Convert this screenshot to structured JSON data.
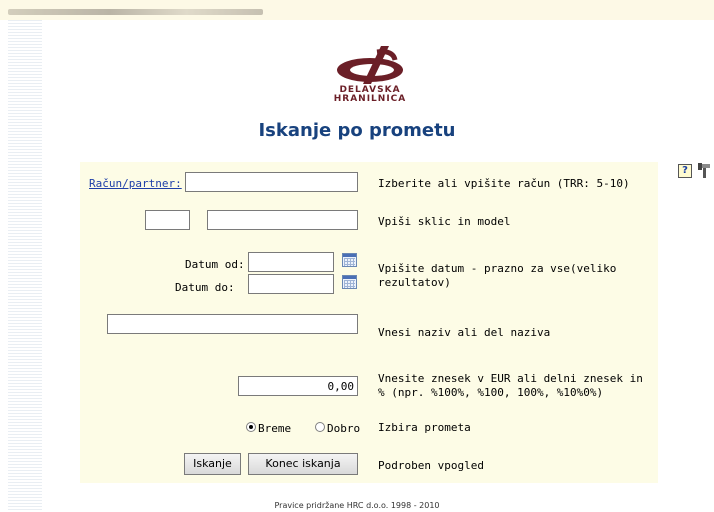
{
  "header": {
    "logo_line1": "DELAVSKA",
    "logo_line2": "HRANILNICA",
    "title": "Iskanje po prometu"
  },
  "form": {
    "account_link": "Račun/partner:",
    "account_value": "",
    "account_hint": "Izberite ali vpišite račun (TRR: 5-10)",
    "reference_model_value": "",
    "reference_value": "",
    "reference_hint": "Vpiši sklic in model",
    "date_from_label": "Datum od:",
    "date_to_label": "Datum do:",
    "date_from_value": "",
    "date_to_value": "",
    "date_hint": "Vpišite datum - prazno za vse(veliko rezultatov)",
    "name_value": "",
    "name_hint": "Vnesi naziv ali del naziva",
    "amount_value": "0,00",
    "amount_hint": "Vnesite znesek v EUR ali delni znesek in % (npr. %100%, %100, 100%, %10%0%)",
    "radio_debit_label": "Breme",
    "radio_credit_label": "Dobro",
    "radio_selected": "Breme",
    "turnover_hint": "Izbira prometa",
    "search_button": "Iskanje",
    "end_search_button": "Konec iskanja",
    "detail_hint": "Podroben vpogled"
  },
  "icons": {
    "help": "help-icon",
    "tools": "tools-icon",
    "calendar": "calendar-icon"
  },
  "footer": {
    "copyright": "Pravice pridržane HRC d.o.o. 1998 - 2010"
  },
  "colors": {
    "title": "#18427e",
    "panel_bg": "#fdfce6",
    "logo": "#6b1f27",
    "link": "#1e3fa8"
  }
}
